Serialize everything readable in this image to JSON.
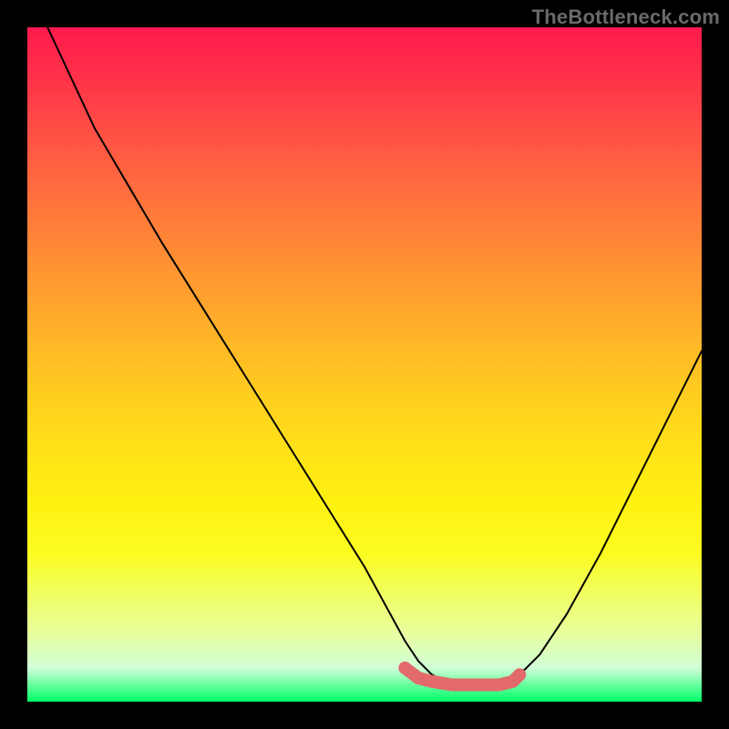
{
  "watermark": "TheBottleneck.com",
  "chart_data": {
    "type": "line",
    "title": "",
    "xlabel": "",
    "ylabel": "",
    "xlim": [
      0,
      100
    ],
    "ylim": [
      0,
      100
    ],
    "series": [
      {
        "name": "bottleneck-curve",
        "x": [
          3,
          10,
          20,
          30,
          40,
          50,
          56,
          58,
          60,
          63,
          66,
          70,
          72,
          73,
          76,
          80,
          85,
          90,
          95,
          100
        ],
        "y": [
          100,
          85,
          68,
          52,
          36,
          20,
          9,
          6,
          4,
          2.5,
          2,
          2,
          2.5,
          4,
          7,
          13,
          22,
          32,
          42,
          52
        ]
      },
      {
        "name": "optimal-band",
        "x": [
          56,
          58,
          60,
          63,
          66,
          70,
          72,
          73
        ],
        "y": [
          5,
          3.5,
          3,
          2.5,
          2.5,
          2.5,
          3,
          4
        ]
      }
    ],
    "colors": {
      "curve": "#000000",
      "optimal": "#e26a6a",
      "gradient_top": "#ff1a4d",
      "gradient_bottom": "#00ff66"
    }
  }
}
